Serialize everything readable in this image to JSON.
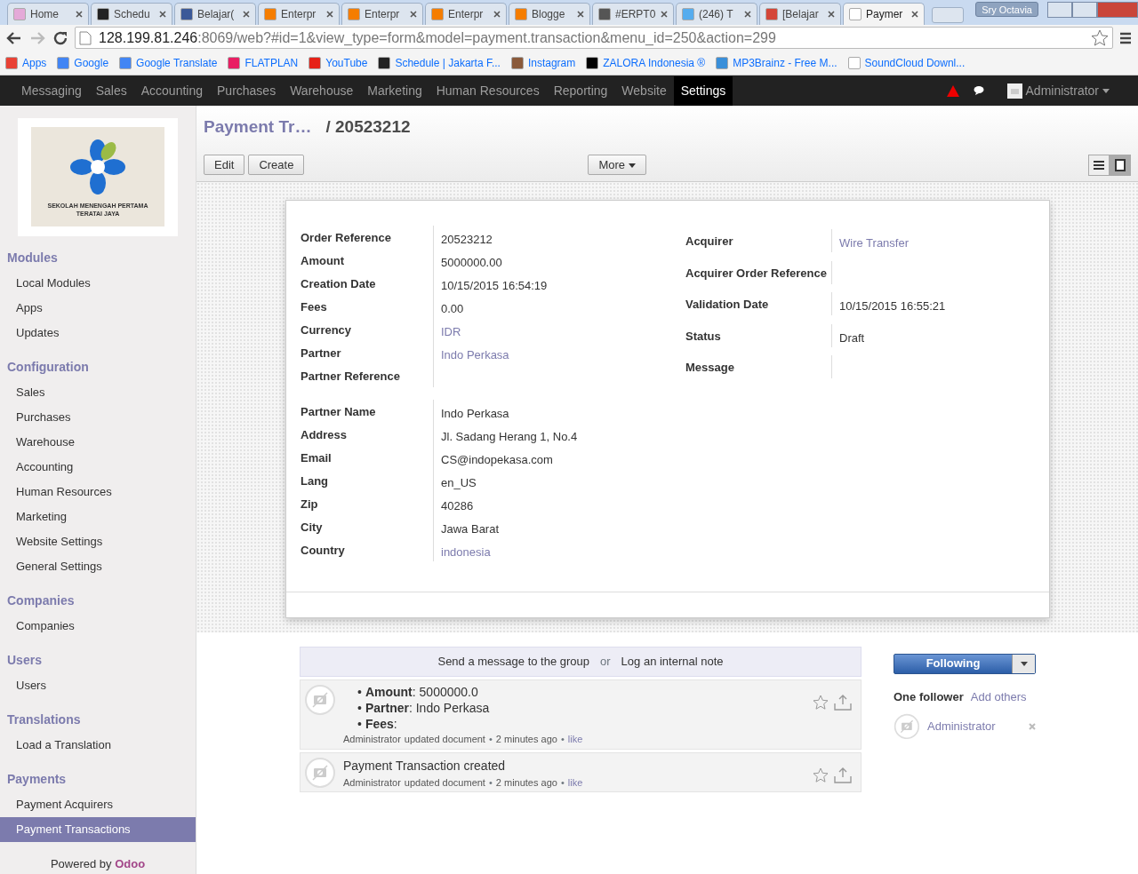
{
  "browser": {
    "tabs": [
      {
        "label": "Home",
        "selected": false,
        "color": "#e4a9d8"
      },
      {
        "label": "Schedu",
        "selected": false,
        "color": "#222222"
      },
      {
        "label": "Belajar(",
        "selected": false,
        "color": "#3b5998"
      },
      {
        "label": "Enterpr",
        "selected": false,
        "color": "#f57d00"
      },
      {
        "label": "Enterpr",
        "selected": false,
        "color": "#f57d00"
      },
      {
        "label": "Enterpr",
        "selected": false,
        "color": "#f57d00"
      },
      {
        "label": "Blogge",
        "selected": false,
        "color": "#f57d00"
      },
      {
        "label": "#ERPT0",
        "selected": false,
        "color": "#555555"
      },
      {
        "label": "(246) T",
        "selected": false,
        "color": "#55acee"
      },
      {
        "label": "[Belajar",
        "selected": false,
        "color": "#d44638"
      },
      {
        "label": "Paymer",
        "selected": true,
        "color": "#ffffff"
      }
    ],
    "user": "Sry Octavia",
    "address": {
      "host": "128.199.81.246",
      "path": ":8069/web?#id=1&view_type=form&model=payment.transaction&menu_id=250&action=299"
    },
    "bookmarks": [
      {
        "label": "Apps",
        "color": "#e94235"
      },
      {
        "label": "Google",
        "color": "#4285f4"
      },
      {
        "label": "Google Translate",
        "color": "#4285f4"
      },
      {
        "label": "FLATPLAN",
        "color": "#e91e63"
      },
      {
        "label": "YouTube",
        "color": "#e62117"
      },
      {
        "label": "Schedule | Jakarta F...",
        "color": "#222222"
      },
      {
        "label": "Instagram",
        "color": "#8a5a3b"
      },
      {
        "label": "ZALORA Indonesia ®",
        "color": "#000000"
      },
      {
        "label": "MP3Brainz - Free M...",
        "color": "#3a8fd9"
      },
      {
        "label": "SoundCloud Downl...",
        "color": "#ffffff"
      }
    ]
  },
  "menu": [
    {
      "label": "Messaging",
      "selected": false
    },
    {
      "label": "Sales",
      "selected": false
    },
    {
      "label": "Accounting",
      "selected": false
    },
    {
      "label": "Purchases",
      "selected": false
    },
    {
      "label": "Warehouse",
      "selected": false
    },
    {
      "label": "Marketing",
      "selected": false
    },
    {
      "label": "Human Resources",
      "selected": false
    },
    {
      "label": "Reporting",
      "selected": false
    },
    {
      "label": "Website",
      "selected": false
    },
    {
      "label": "Settings",
      "selected": true
    }
  ],
  "menu_user": "Administrator",
  "logo": {
    "line1": "SEKOLAH MENENGAH PERTAMA",
    "line2": "TERATAI JAYA"
  },
  "sidebar": [
    {
      "title": "Modules",
      "items": [
        {
          "label": "Local Modules",
          "selected": false
        },
        {
          "label": "Apps",
          "selected": false
        },
        {
          "label": "Updates",
          "selected": false
        }
      ]
    },
    {
      "title": "Configuration",
      "items": [
        {
          "label": "Sales",
          "selected": false
        },
        {
          "label": "Purchases",
          "selected": false
        },
        {
          "label": "Warehouse",
          "selected": false
        },
        {
          "label": "Accounting",
          "selected": false
        },
        {
          "label": "Human Resources",
          "selected": false
        },
        {
          "label": "Marketing",
          "selected": false
        },
        {
          "label": "Website Settings",
          "selected": false
        },
        {
          "label": "General Settings",
          "selected": false
        }
      ]
    },
    {
      "title": "Companies",
      "items": [
        {
          "label": "Companies",
          "selected": false
        }
      ]
    },
    {
      "title": "Users",
      "items": [
        {
          "label": "Users",
          "selected": false
        }
      ]
    },
    {
      "title": "Translations",
      "items": [
        {
          "label": "Load a Translation",
          "selected": false
        }
      ]
    },
    {
      "title": "Payments",
      "items": [
        {
          "label": "Payment Acquirers",
          "selected": false
        },
        {
          "label": "Payment Transactions",
          "selected": true
        }
      ]
    }
  ],
  "footer": {
    "text": "Powered by",
    "brand": "Odoo"
  },
  "breadcrumb": {
    "parent": "Payment Tr…",
    "current": "/ 20523212"
  },
  "buttons": {
    "edit": "Edit",
    "create": "Create",
    "more": "More"
  },
  "form": {
    "left": [
      {
        "label": "Order Reference",
        "value": "20523212"
      },
      {
        "label": "Amount",
        "value": "5000000.00"
      },
      {
        "label": "Creation Date",
        "value": "10/15/2015 16:54:19"
      },
      {
        "label": "Fees",
        "value": "0.00"
      },
      {
        "label": "Currency",
        "value": "IDR",
        "link": true
      },
      {
        "label": "Partner",
        "value": "Indo Perkasa",
        "link": true
      },
      {
        "label": "Partner Reference"
      }
    ],
    "right": [
      {
        "label": "Acquirer",
        "value": "Wire Transfer",
        "link": true
      },
      {
        "label": "Acquirer Order Reference"
      },
      {
        "label": "Validation Date",
        "value": "10/15/2015 16:55:21"
      },
      {
        "label": "Status",
        "value": "Draft"
      },
      {
        "label": "Message"
      }
    ],
    "partner": [
      {
        "label": "Partner Name",
        "value": "Indo Perkasa"
      },
      {
        "label": "Address",
        "value": "Jl. Sadang Herang 1, No.4"
      },
      {
        "label": "Email",
        "value": "CS@indopekasa.com"
      },
      {
        "label": "Lang",
        "value": "en_US"
      },
      {
        "label": "Zip",
        "value": "40286"
      },
      {
        "label": "City",
        "value": "Jawa Barat"
      },
      {
        "label": "Country",
        "value": "indonesia",
        "link": true
      }
    ]
  },
  "chatter": {
    "send": "Send a message to the group",
    "or": "or",
    "log": "Log an internal note",
    "bullet": "•",
    "separator": "•",
    "messages": [
      {
        "kind": "changes",
        "changes": [
          {
            "label": "Amount",
            "value": ": 5000000.0"
          },
          {
            "label": "Partner",
            "value": ": Indo Perkasa"
          },
          {
            "label": "Fees",
            "value": ":"
          }
        ],
        "author": "Administrator",
        "action": "updated document",
        "time": "2 minutes ago",
        "like": "like"
      },
      {
        "kind": "text",
        "text": "Payment Transaction created",
        "author": "Administrator",
        "action": "updated document",
        "time": "2 minutes ago",
        "like": "like"
      }
    ],
    "following": "Following",
    "followers_count": "One follower",
    "add": "Add others",
    "followers": [
      {
        "name": "Administrator"
      }
    ]
  }
}
